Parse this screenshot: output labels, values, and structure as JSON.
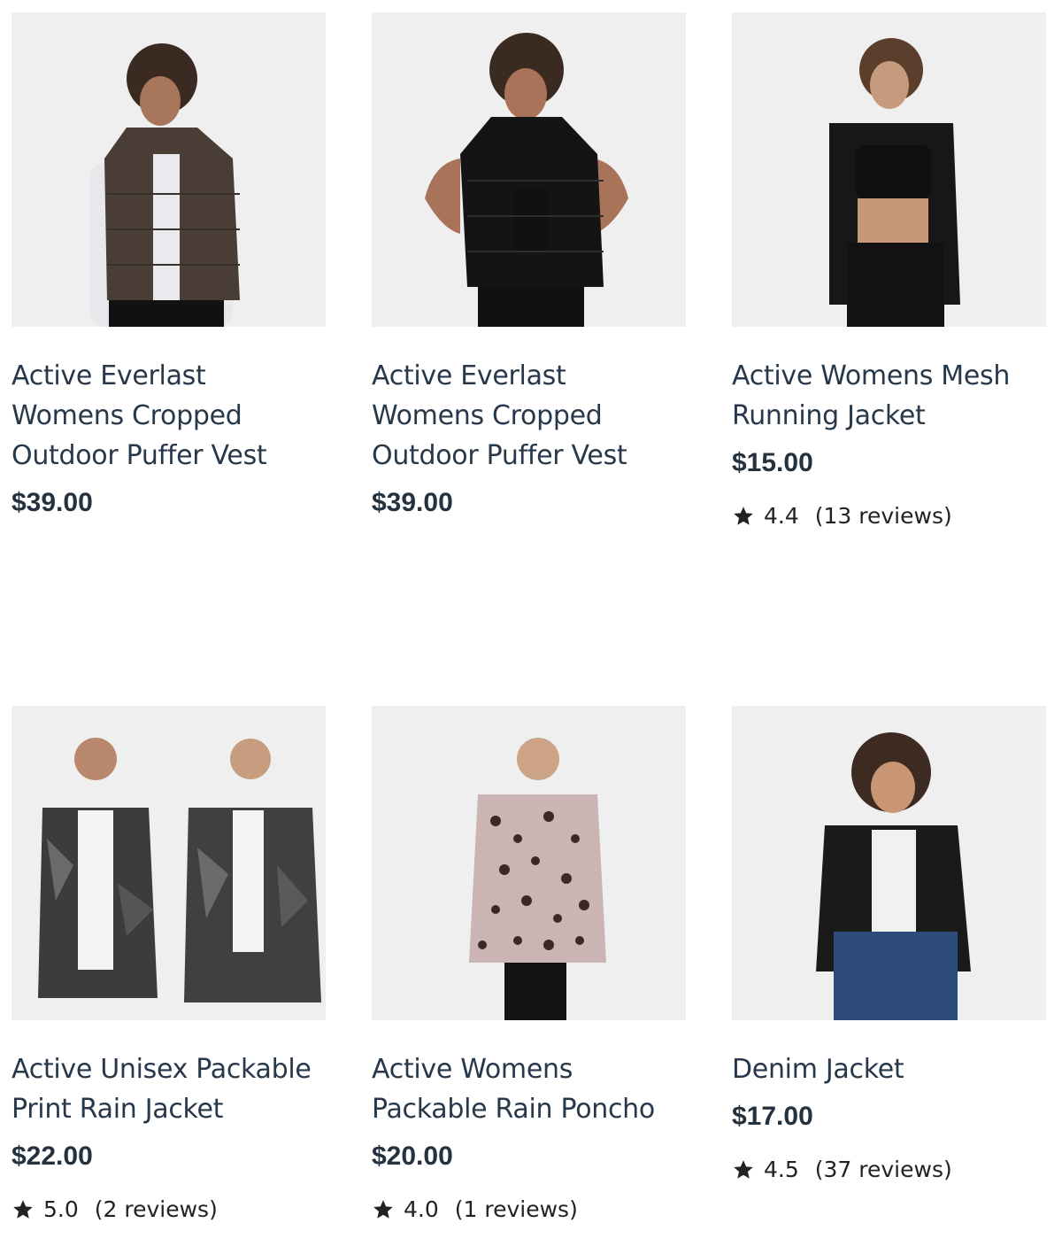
{
  "products": [
    {
      "title": "Active Everlast Womens Cropped Outdoor Puffer Vest",
      "price": "$39.00",
      "image_icon": "brown-puffer-vest-photo"
    },
    {
      "title": "Active Everlast Womens Cropped Outdoor Puffer Vest",
      "price": "$39.00",
      "image_icon": "black-puffer-vest-photo"
    },
    {
      "title": "Active Womens Mesh Running Jacket",
      "price": "$15.00",
      "rating": "4.4",
      "reviews": "(13 reviews)",
      "image_icon": "black-mesh-jacket-photo"
    },
    {
      "title": "Active Unisex Packable Print Rain Jacket",
      "price": "$22.00",
      "rating": "5.0",
      "reviews": "(2 reviews)",
      "image_icon": "camo-rain-jacket-photo"
    },
    {
      "title": "Active Womens Packable Rain Poncho",
      "price": "$20.00",
      "rating": "4.0",
      "reviews": "(1 reviews)",
      "image_icon": "leopard-poncho-photo"
    },
    {
      "title": "Denim Jacket",
      "price": "$17.00",
      "rating": "4.5",
      "reviews": "(37 reviews)",
      "image_icon": "black-denim-jacket-photo"
    }
  ],
  "colors": {
    "image_bg": "#efefef",
    "title": "#27384a",
    "price": "#24313f",
    "star": "#222222"
  }
}
